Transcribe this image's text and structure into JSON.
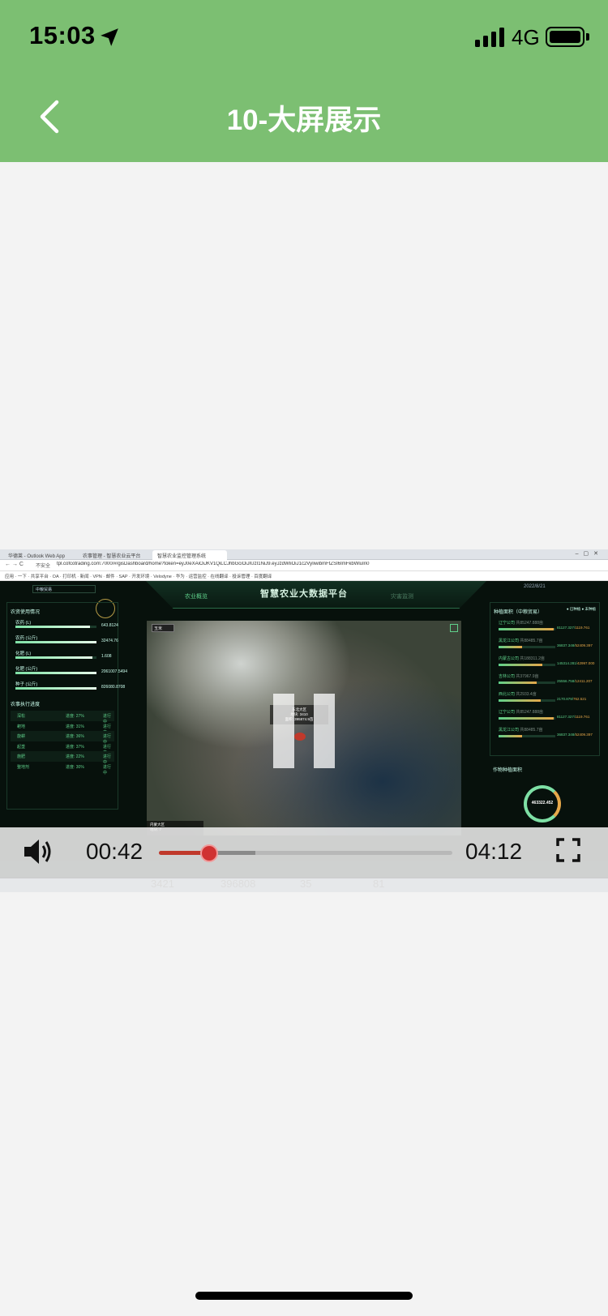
{
  "status_bar": {
    "time": "15:03",
    "network": "4G"
  },
  "nav": {
    "title": "10-大屏展示"
  },
  "browser": {
    "tabs": [
      "华德莱 - Outlook Web App",
      "农事管理 - 智慧农业云平台",
      "智慧农业监控管理系统"
    ],
    "url": "tpl.cofcotrading.com:7000/#/gisDashboard/home?token=eyJ0eXAiOiJKV1QiLCJhbGciOiJIUzI1NiJ9.eyJzdWIiOiJ1c2VyIiwibmFtZSI6ImFkbWluIn0",
    "warning": "不安全",
    "bookmarks": "应用 · 一下 · 共享平台 · OA · 打印机 · 新闻 · VPN · 邮件 · SAP · 开发环境 · Velodyne · 华为 · 运营监控 · 在线翻译 · 投诉管理 · 百度翻译"
  },
  "dashboard": {
    "title": "智慧农业大数据平台",
    "tab_left": "农业概览",
    "tab_right": "灾害监测",
    "date": "2022/8/21",
    "org_select": "中粮贸易",
    "left_title": "农资使用情况",
    "materials": [
      {
        "label": "农药 (L)",
        "value": "643.8124",
        "fill": 0.92
      },
      {
        "label": "农药 (公斤)",
        "value": "32474.76",
        "fill": 1.0
      },
      {
        "label": "化肥 (L)",
        "value": "1.608",
        "fill": 0.95
      },
      {
        "label": "化肥 (公斤)",
        "value": "2061007.5494",
        "fill": 1.0
      },
      {
        "label": "种子 (公斤)",
        "value": "826080.8708",
        "fill": 1.0
      }
    ],
    "task_title": "农事执行进度",
    "tasks": [
      {
        "name": "深松",
        "progress": "进度: 27%",
        "status": "进行中"
      },
      {
        "name": "耙地",
        "progress": "进度: 31%",
        "status": "进行中"
      },
      {
        "name": "旋耕",
        "progress": "进度: 36%",
        "status": "进行中"
      },
      {
        "name": "起垄",
        "progress": "进度: 37%",
        "status": "进行中"
      },
      {
        "name": "施肥",
        "progress": "进度: 22%",
        "status": "进行中"
      },
      {
        "name": "整地剂",
        "progress": "进度: 30%",
        "status": "进行中"
      }
    ],
    "map_select": "玉米",
    "map_popup": {
      "title": "东北大区",
      "line1": "地块: 3410",
      "line2": "面积: 395874.9亩"
    },
    "map_region": {
      "title": "内蒙大区",
      "line1": "地块: 7"
    },
    "right_title": "种植面积（中粮贸易）",
    "legend": [
      "已种植",
      "未种植"
    ],
    "companies": [
      {
        "name": "辽宁公司",
        "sub": "共85247.888亩",
        "a": "81127.327",
        "b": "1119.761",
        "fill": 0.97
      },
      {
        "name": "黑龙江公司",
        "sub": "共88485.7亩",
        "a": "36837.348",
        "b": "52409.397",
        "fill": 0.42
      },
      {
        "name": "内蒙古公司",
        "sub": "共188311.2亩",
        "a": "145314.281",
        "b": "42997.000",
        "fill": 0.77
      },
      {
        "name": "吉林公司",
        "sub": "共37967.9亩",
        "a": "25556.758",
        "b": "12411.207",
        "fill": 0.67
      },
      {
        "name": "西北公司",
        "sub": "共2933.4亩",
        "a": "2170.879",
        "b": "762.521",
        "fill": 0.74
      },
      {
        "name": "辽宁公司",
        "sub": "共85247.888亩",
        "a": "81127.327",
        "b": "1119.761",
        "fill": 0.97
      },
      {
        "name": "黑龙江公司",
        "sub": "共88485.7亩",
        "a": "36837.348",
        "b": "52409.397",
        "fill": 0.42
      }
    ],
    "crop_title": "作物种植面积",
    "donut_value": "463322.452",
    "donut_label": "种植面积"
  },
  "player": {
    "current_time": "00:42",
    "total_time": "04:12",
    "progress": 0.17,
    "buffered": 0.33
  },
  "stats_strip": [
    "3421",
    "396808",
    "35",
    "81"
  ]
}
